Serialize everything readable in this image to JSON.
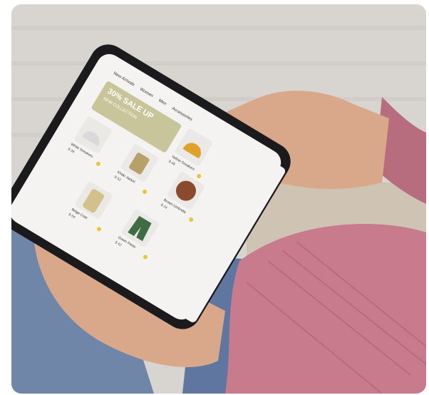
{
  "scene": {
    "description_label": "",
    "colors": {
      "background": "#d6d3cf",
      "wall": "#e4e2df",
      "jeans": "#6f86a8",
      "sweater": "#c77b8d",
      "skin": "#d9a88a",
      "phone_frame": "#1b1b1d",
      "screen": "#f4f3f1",
      "accent_yellow": "#e9c63a",
      "banner": "#c9c59a"
    }
  },
  "phone_app": {
    "tabs": [
      "New Arrivals",
      "Women",
      "Men",
      "Accessories"
    ],
    "banner": {
      "headline": "30% SALE UP",
      "subline": "NEW COLLECTION"
    },
    "products": [
      {
        "name": "Yellow Sneakers",
        "price": "$ 48",
        "icon": "shoe-icon"
      },
      {
        "name": "White Sneakers",
        "price": "$ 36",
        "icon": "shoe-icon"
      },
      {
        "name": "Khaki Jacket",
        "price": "$ 52",
        "icon": "jacket-icon"
      },
      {
        "name": "Brown Umbrella",
        "price": "$ 24",
        "icon": "umbrella-icon"
      },
      {
        "name": "Beige Coat",
        "price": "$ 64",
        "icon": "coat-icon"
      },
      {
        "name": "Green Pants",
        "price": "$ 42",
        "icon": "pants-icon"
      }
    ]
  }
}
